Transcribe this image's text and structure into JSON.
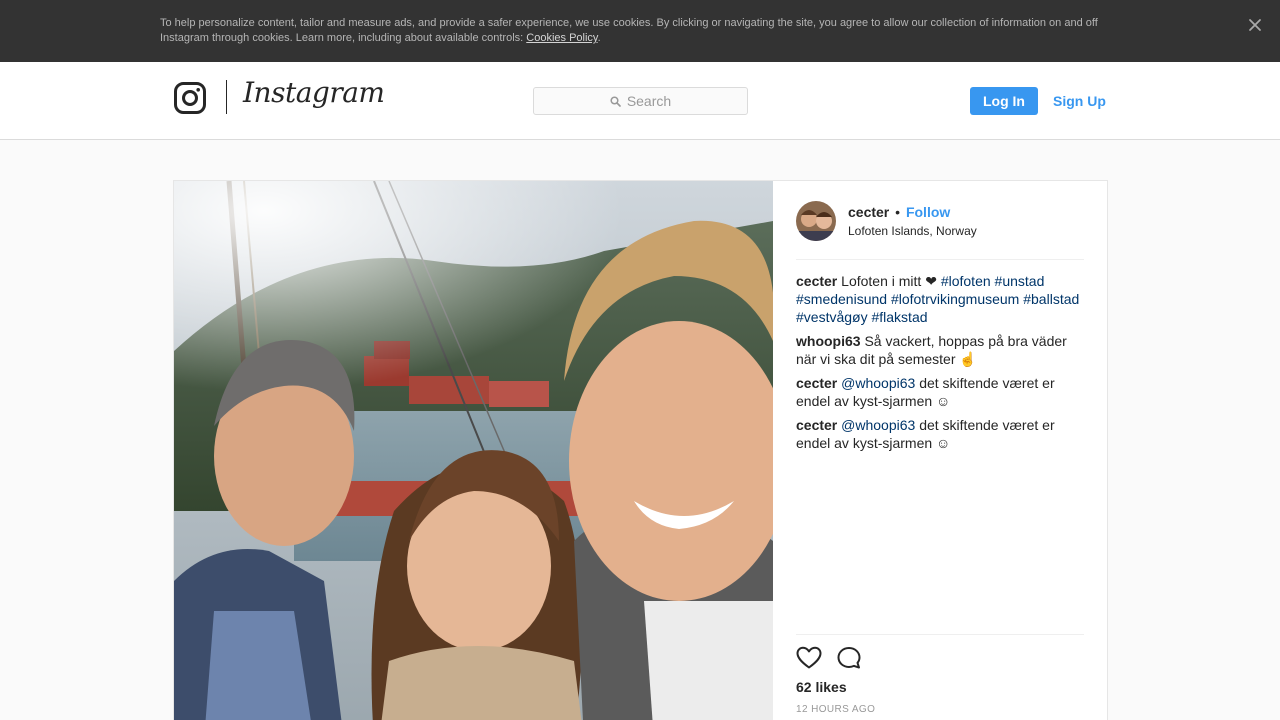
{
  "cookie_banner": {
    "text": "To help personalize content, tailor and measure ads, and provide a safer experience, we use cookies. By clicking or navigating the site, you agree to allow our collection of information on and off Instagram through cookies. Learn more, including about available controls: ",
    "link_text": "Cookies Policy",
    "trailing": ".",
    "close_icon": "close-icon"
  },
  "nav": {
    "logo_glyph": "instagram-camera-icon",
    "wordmark": "Instagram",
    "search_placeholder": "Search",
    "login_label": "Log In",
    "signup_label": "Sign Up"
  },
  "post": {
    "author": "cecter",
    "separator": "•",
    "follow_label": "Follow",
    "location": "Lofoten Islands, Norway",
    "caption": {
      "user": "cecter",
      "text": "Lofoten i mitt ❤",
      "hashtags": [
        "#lofoten",
        "#unstad",
        "#smedenisund",
        "#lofotrvikingmuseum",
        "#ballstad",
        "#vestvågøy",
        "#flakstad"
      ]
    },
    "comments": [
      {
        "user": "whoopi63",
        "mention": "",
        "text": "Så vackert, hoppas på bra väder när vi ska dit på semester ☝"
      },
      {
        "user": "cecter",
        "mention": "@whoopi63",
        "text": "det skiftende været er endel av kyst-sjarmen ☺"
      },
      {
        "user": "cecter",
        "mention": "@whoopi63",
        "text": "det skiftende været er endel av kyst-sjarmen ☺"
      }
    ],
    "likes": "62 likes",
    "timestamp": "12 HOURS AGO"
  },
  "colors": {
    "accent": "#3897f0",
    "hashtag": "#003569",
    "banner_bg": "#333333"
  }
}
